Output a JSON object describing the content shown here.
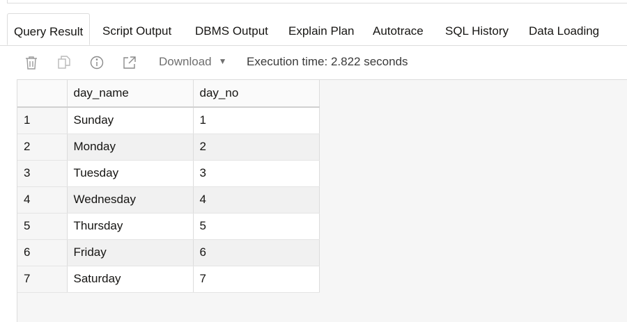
{
  "tabs": [
    "Query Result",
    "Script Output",
    "DBMS Output",
    "Explain Plan",
    "Autotrace",
    "SQL History",
    "Data Loading"
  ],
  "toolbar": {
    "icons": [
      "trash-icon",
      "copy-icon",
      "info-icon",
      "open-external-icon"
    ],
    "download_label": "Download",
    "execution_time": "Execution time: 2.822 seconds"
  },
  "grid": {
    "columns": [
      "day_name",
      "day_no"
    ],
    "rows": [
      {
        "rownum": "1",
        "day_name": "Sunday",
        "day_no": "1"
      },
      {
        "rownum": "2",
        "day_name": "Monday",
        "day_no": "2"
      },
      {
        "rownum": "3",
        "day_name": "Tuesday",
        "day_no": "3"
      },
      {
        "rownum": "4",
        "day_name": "Wednesday",
        "day_no": "4"
      },
      {
        "rownum": "5",
        "day_name": "Thursday",
        "day_no": "5"
      },
      {
        "rownum": "6",
        "day_name": "Friday",
        "day_no": "6"
      },
      {
        "rownum": "7",
        "day_name": "Saturday",
        "day_no": "7"
      }
    ]
  }
}
